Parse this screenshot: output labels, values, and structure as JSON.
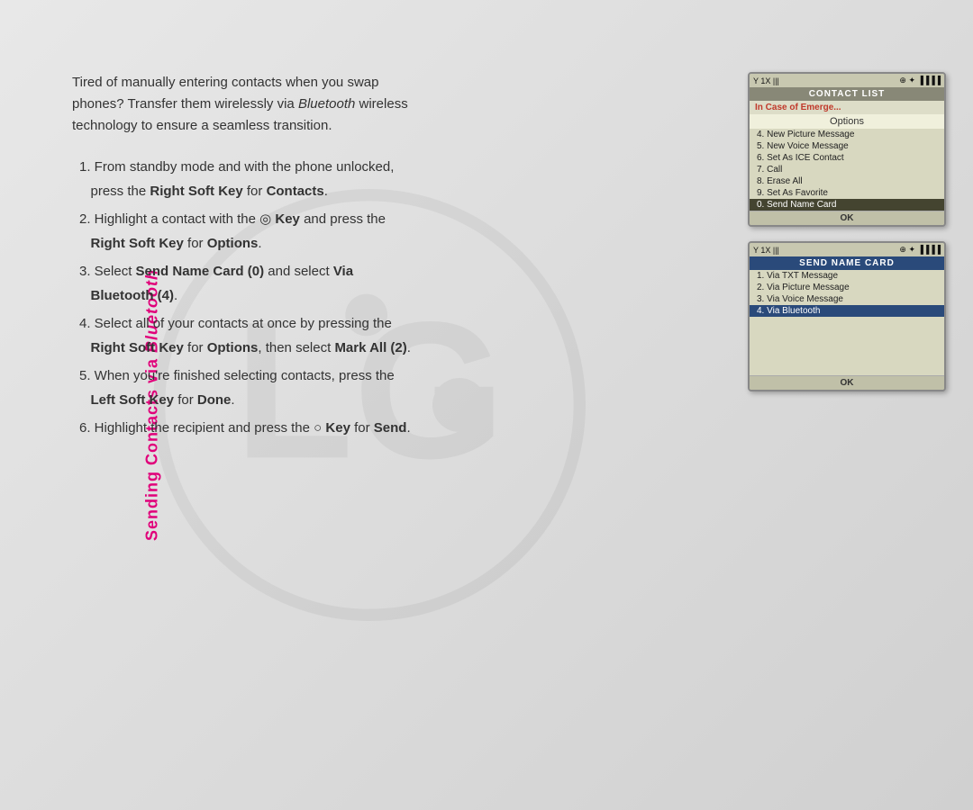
{
  "page": {
    "side_label": "Sending Contacts via Bluetooth"
  },
  "intro": {
    "line1": "Tired of manually entering contacts when you swap",
    "line2": "phones? Transfer them wirelessly via ",
    "bluetooth_italic": "Bluetooth",
    "line2_end": " wireless",
    "line3": "technology to ensure a seamless transition."
  },
  "steps": [
    {
      "number": "1.",
      "text_before": "From standby mode and with the phone unlocked, press the ",
      "bold1": "Right Soft Key",
      "text_mid": " for ",
      "bold2": "Contacts",
      "text_after": "."
    },
    {
      "number": "2.",
      "text_before": "Highlight a contact with the ",
      "bold1": "Key",
      "text_mid": " and press the ",
      "bold2": "Right Soft Key",
      "text_after": " for ",
      "bold3": "Options",
      "end": "."
    },
    {
      "number": "3.",
      "text_before": "Select ",
      "bold1": "Send Name Card (0)",
      "text_mid": " and select ",
      "bold2": "Via Bluetooth (4)",
      "end": "."
    },
    {
      "number": "4.",
      "text_before": "Select all of your contacts at once by pressing the ",
      "bold1": "Right Soft Key",
      "text_mid": " for ",
      "bold2": "Options",
      "text_after": ", then select ",
      "bold3": "Mark All (2)",
      "end": "."
    },
    {
      "number": "5.",
      "text_before": "When you're finished selecting contacts, press the ",
      "bold1": "Left Soft Key",
      "text_mid": " for ",
      "bold2": "Done",
      "end": "."
    },
    {
      "number": "6.",
      "text_before": "Highlight the recipient and press the ",
      "bold1": "Key",
      "text_mid": " for ",
      "bold2": "Send",
      "end": "."
    }
  ],
  "phone1": {
    "status_signal": "Y1X|||",
    "status_icons": "⊕ * ▐▐▐▐",
    "title": "CONTACT LIST",
    "subtitle": "In Case of Emerge...",
    "options_header": "Options",
    "menu_items": [
      {
        "num": "4.",
        "label": "New Picture Message",
        "selected": false
      },
      {
        "num": "5.",
        "label": "New Voice Message",
        "selected": false
      },
      {
        "num": "6.",
        "label": "Set As ICE Contact",
        "selected": false
      },
      {
        "num": "7.",
        "label": "Call",
        "selected": false
      },
      {
        "num": "8.",
        "label": "Erase All",
        "selected": false
      },
      {
        "num": "9.",
        "label": "Set As Favorite",
        "selected": false
      },
      {
        "num": "0.",
        "label": "Send Name Card",
        "selected": true
      }
    ],
    "ok_label": "OK"
  },
  "phone2": {
    "status_signal": "Y1X|||",
    "status_icons": "⊕ * ▐▐▐▐",
    "title": "SEND NAME CARD",
    "menu_items": [
      {
        "num": "1.",
        "label": "Via TXT Message",
        "selected": false
      },
      {
        "num": "2.",
        "label": "Via Picture Message",
        "selected": false
      },
      {
        "num": "3.",
        "label": "Via Voice Message",
        "selected": false
      },
      {
        "num": "4.",
        "label": "Via Bluetooth",
        "selected": true
      }
    ],
    "ok_label": "OK"
  }
}
